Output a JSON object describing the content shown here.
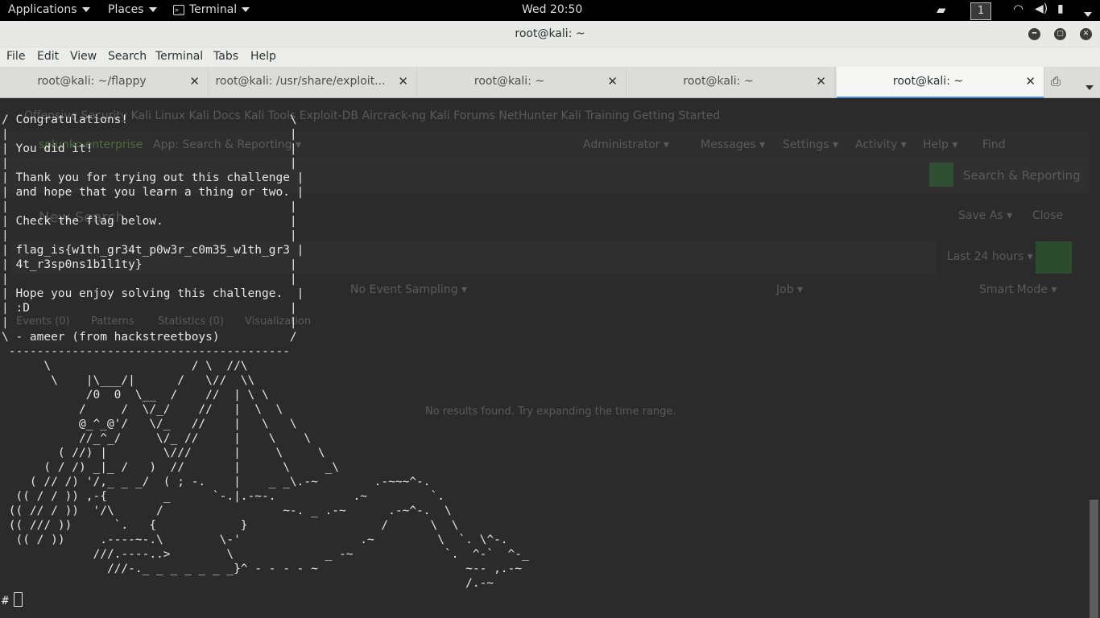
{
  "topbar": {
    "applications": "Applications",
    "places": "Places",
    "terminal": "Terminal",
    "clock": "Wed 20:50",
    "workspace": "1"
  },
  "window": {
    "title": "root@kali: ~"
  },
  "menu": [
    "File",
    "Edit",
    "View",
    "Search",
    "Terminal",
    "Tabs",
    "Help"
  ],
  "tabs": [
    {
      "label": "root@kali: ~/flappy"
    },
    {
      "label": "root@kali: /usr/share/exploit..."
    },
    {
      "label": "root@kali: ~"
    },
    {
      "label": "root@kali: ~"
    },
    {
      "label": "root@kali: ~"
    }
  ],
  "background_ghost": {
    "bookmarks": "Offensive Security   Kali Linux   Kali Docs   Kali Tools   Exploit-DB   Aircrack-ng   Kali Forums   NetHunter   Kali Training   Getting Started",
    "splunk_brand": "splunk>enterprise",
    "app_menu": "App: Search & Reporting ▾",
    "admin": "Administrator ▾",
    "messages": "Messages ▾",
    "settings": "Settings ▾",
    "activity": "Activity ▾",
    "help": "Help ▾",
    "find": "Find",
    "search_reporting": "Search & Reporting",
    "new_search": "New Search",
    "save_as": "Save As ▾",
    "close": "Close",
    "time_range": "Last 24 hours ▾",
    "event_sampling": "No Event Sampling ▾",
    "job": "Job ▾",
    "smart_mode": "Smart Mode ▾",
    "events": "Events (0)",
    "patterns": "Patterns",
    "statistics": "Statistics (0)",
    "visualization": "Visualization",
    "no_results": "No results found. Try expanding the time range."
  },
  "terminal_lines": [
    "/ Congratulations!                       \\",
    "|                                        |",
    "| You did it!                            |",
    "|                                        |",
    "| Thank you for trying out this challenge |",
    "| and hope that you learn a thing or two. |",
    "|                                        |",
    "| Check the flag below.                  |",
    "|                                        |",
    "| flag_is{w1th_gr34t_p0w3r_c0m35_w1th_gr3 |",
    "| 4t_r3sp0ns1b1l1ty}                     |",
    "|                                        |",
    "| Hope you enjoy solving this challenge.  |",
    "| :D                                     |",
    "|                                        |",
    "\\ - ameer (from hackstreetboys)          /",
    " ----------------------------------------",
    "      \\                    / \\  //\\",
    "       \\    |\\___/|      /   \\//  \\\\",
    "            /0  0  \\__  /    //  | \\ \\",
    "           /     /  \\/_/    //   |  \\  \\",
    "           @_^_@'/   \\/_   //    |   \\   \\",
    "           //_^_/     \\/_ //     |    \\    \\",
    "        ( //) |        \\///      |     \\     \\",
    "      ( / /) _|_ /   )  //       |      \\     _\\",
    "    ( // /) '/,_ _ _/  ( ; -.    |    _ _\\.-~        .-~~~^-.",
    "  (( / / )) ,-{        _      `-.|.-~-.           .~         `.",
    " (( // / ))  '/\\      /                 ~-. _ .-~      .-~^-.  \\",
    " (( /// ))      `.   {            }                   /      \\  \\",
    "  (( / ))     .----~-.\\        \\-'                 .~         \\  `. \\^-.",
    "             ///.----..>        \\             _ -~             `.  ^-`  ^-_",
    "               ///-._ _ _ _ _ _ _}^ - - - - ~                     ~-- ,.-~",
    "                                                                  /.-~"
  ],
  "prompt": "#"
}
